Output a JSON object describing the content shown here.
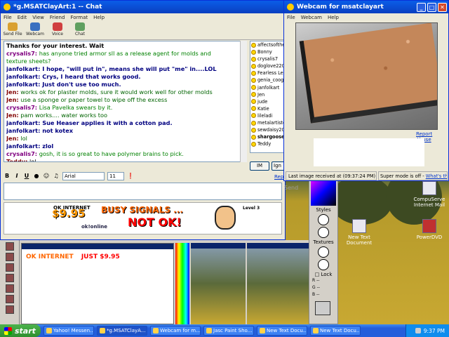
{
  "chat": {
    "title": "*g.MSATClayArt:1 -- Chat",
    "menu": [
      "File",
      "Edit",
      "View",
      "Friend",
      "Format",
      "Help"
    ],
    "toolbar": [
      {
        "label": "Send File",
        "icon": "send-file-icon",
        "color": "#d9a030"
      },
      {
        "label": "Webcam",
        "icon": "webcam-icon",
        "color": "#3a70c0"
      },
      {
        "label": "Voice",
        "icon": "voice-icon",
        "color": "#d04040"
      },
      {
        "label": "Chat",
        "icon": "chat-icon",
        "color": "#60a060"
      }
    ],
    "messages": [
      {
        "user": "",
        "text": "Thanks for your interest. Wait",
        "ucls": "u1",
        "tcls": "t1",
        "bold": true
      },
      {
        "user": "crysalis7:",
        "text": " has anyone tried armor sll as a release agent for molds and",
        "ucls": "u1",
        "tcls": "t2"
      },
      {
        "user": "",
        "text": "  texture sheets?",
        "ucls": "u1",
        "tcls": "t2"
      },
      {
        "user": "janfolkart:",
        "text": " I hope, \"will put in\", means she will put \"me\" in....LOL",
        "ucls": "u2",
        "tcls": "u2"
      },
      {
        "user": "janfolkart:",
        "text": " Crys, I heard that works good.",
        "ucls": "u2",
        "tcls": "u2"
      },
      {
        "user": "janfolkart:",
        "text": " Just don't use too much.",
        "ucls": "u2",
        "tcls": "u2"
      },
      {
        "user": "Jen:",
        "text": " works ok for plaster molds, sure it would work well for other molds",
        "ucls": "u3",
        "tcls": "t3"
      },
      {
        "user": "Jen:",
        "text": " use a sponge or paper towel to wipe off the excess",
        "ucls": "u3",
        "tcls": "t3"
      },
      {
        "user": "crysalis7:",
        "text": " Lisa Pavelka swears by it.",
        "ucls": "u1",
        "tcls": "t2"
      },
      {
        "user": "Jen:",
        "text": " pam works.... water works too",
        "ucls": "u3",
        "tcls": "t3"
      },
      {
        "user": "janfolkart:",
        "text": " Sue Heaser applies it with a cotton pad.",
        "ucls": "u2",
        "tcls": "u2"
      },
      {
        "user": "janfolkart:",
        "text": " not kotex",
        "ucls": "u2",
        "tcls": "u2"
      },
      {
        "user": "Jen:",
        "text": " lol",
        "ucls": "u3",
        "tcls": "t3"
      },
      {
        "user": "janfolkart:",
        "text": " zlol",
        "ucls": "u2",
        "tcls": "u2"
      },
      {
        "user": "crysalis7:",
        "text": " gosh, it is so great to have polymer brains to pick.",
        "ucls": "u1",
        "tcls": "t2"
      },
      {
        "user": "Teddy:",
        "text": " lol",
        "ucls": "u3",
        "tcls": "t1"
      }
    ],
    "buddies": [
      "affectsofthe",
      "Bonny",
      "crysalis7",
      "doglove220",
      "Fearless Le",
      "genia_coog",
      "janfolkart",
      "Jen",
      "jude",
      "Katie",
      "lileladi",
      "metalartiste",
      "sewdaisy20",
      "shargoose",
      "Teddy"
    ],
    "im_label": "IM",
    "ignore_label": "Ign",
    "report_label": "Rep",
    "format": {
      "bold": "B",
      "italic": "I",
      "underline": "U",
      "font": "Arial",
      "size": "11"
    },
    "send_label": "Send",
    "ad": {
      "top": "OK INTERNET",
      "price": "$9.95",
      "brand": "ok!online",
      "busy": "BUSY SIGNALS ...",
      "notok": "NOT OK!",
      "level": "Level 3"
    }
  },
  "webcam": {
    "title": "Webcam for msatclayart",
    "menu": [
      "File",
      "Webcam",
      "Help"
    ],
    "report_abuse": "Report Abuse",
    "status": "Last image received at (09:37:24 PM)",
    "super_mode": "Super mode is off - ",
    "whats_this": "What's this?"
  },
  "psp": {
    "ad_text": "JUST $9.95",
    "ad_top": "OK INTERNET",
    "palette": {
      "styles": "Styles",
      "textures": "Textures",
      "lock": "Lock",
      "r": "R",
      "g": "G",
      "b": "B",
      "dash1": "--",
      "dash2": "--",
      "dash3": "--"
    }
  },
  "desktop": {
    "icons": [
      "CompuServe Internet Mail",
      "New Text Document",
      "PowerDVD"
    ]
  },
  "taskbar": {
    "start": "start",
    "tasks": [
      "Yahoo! Messen...",
      "*g.MSATClayA...",
      "Webcam for m...",
      "Jasc Paint Sho...",
      "New Text Docu...",
      "New Text Docu..."
    ],
    "clock": "9:37 PM"
  },
  "colors": {
    "xp_blue": "#0a3fc0",
    "start_green": "#2f8f2f",
    "link": "#0033cc"
  }
}
